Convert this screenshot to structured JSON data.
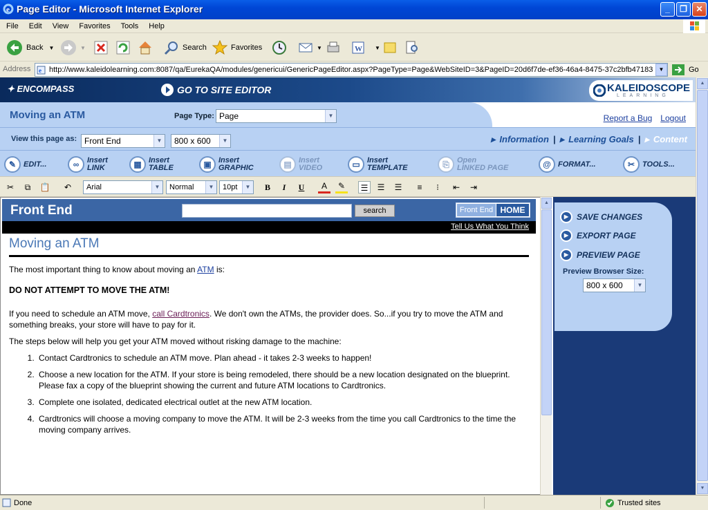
{
  "window": {
    "title": "Page Editor - Microsoft Internet Explorer"
  },
  "menu": [
    "File",
    "Edit",
    "View",
    "Favorites",
    "Tools",
    "Help"
  ],
  "toolbar": {
    "back": "Back",
    "search": "Search",
    "favorites": "Favorites"
  },
  "address": {
    "label": "Address",
    "url": "http://www.kaleidolearning.com:8087/qa/EurekaQA/modules/genericui/GenericPageEditor.aspx?PageType=Page&WebSiteID=3&PageID=20d6f7de-ef36-46a4-8475-37c2bfb47183",
    "go": "Go"
  },
  "banner": {
    "brand": "ENCOMPASS",
    "goto": "GO TO SITE EDITOR",
    "logo_main": "KALEIDOSCOPE",
    "logo_sub": "LEARNING"
  },
  "page_header": {
    "page_name": "Moving an ATM",
    "page_type_label": "Page Type:",
    "page_type_value": "Page",
    "report_bug": "Report a Bug",
    "logout": "Logout"
  },
  "view_row": {
    "label": "View this page as:",
    "view_value": "Front End",
    "size_value": "800 x 600",
    "tabs": [
      "Information",
      "Learning Goals",
      "Content"
    ]
  },
  "actions": {
    "edit": "EDIT...",
    "link_a": "Insert",
    "link_b": "LINK",
    "table_a": "Insert",
    "table_b": "TABLE",
    "graphic_a": "Insert",
    "graphic_b": "GRAPHIC",
    "video_a": "Insert",
    "video_b": "VIDEO",
    "template_a": "Insert",
    "template_b": "TEMPLATE",
    "linked_a": "Open",
    "linked_b": "LINKED PAGE",
    "format": "FORMAT...",
    "tools": "TOOLS..."
  },
  "format_bar": {
    "font": "Arial",
    "style": "Normal",
    "size": "10pt"
  },
  "editor": {
    "header_title": "Front End",
    "search_button": "search",
    "home_a": "Front End",
    "home_b": "HOME",
    "feedback": "Tell Us What You Think",
    "heading": "Moving an ATM",
    "p1_pre": "The most important thing to know about moving an ",
    "p1_link": "ATM",
    "p1_post": " is:",
    "warning": "DO NOT ATTEMPT TO MOVE THE ATM!",
    "p2_pre": "If you need to schedule an ATM move, ",
    "p2_link": "call Cardtronics",
    "p2_post": ". We don't own the ATMs, the provider does. So...if you try to move the ATM and something breaks, your store will have to pay for it.",
    "p3": "The steps below will help you get your ATM moved without risking damage to the machine:",
    "steps": [
      "Contact Cardtronics to schedule an ATM move. Plan ahead - it takes 2-3 weeks to happen!",
      "Choose a new location for the ATM. If your store is being remodeled, there should be a new location designated on the blueprint. Please fax a copy of the blueprint showing the current and future ATM locations to Cardtronics.",
      "Complete one isolated, dedicated electrical outlet at the new ATM location.",
      "Cardtronics will choose a moving company to move the ATM. It will be 2-3 weeks from the time you call Cardtronics to the time the moving company arrives."
    ]
  },
  "right_panel": {
    "save": "SAVE CHANGES",
    "export": "EXPORT PAGE",
    "preview": "PREVIEW PAGE",
    "browser_size_label": "Preview Browser Size:",
    "browser_size_value": "800 x 600"
  },
  "status": {
    "left": "Done",
    "right": "Trusted sites"
  }
}
